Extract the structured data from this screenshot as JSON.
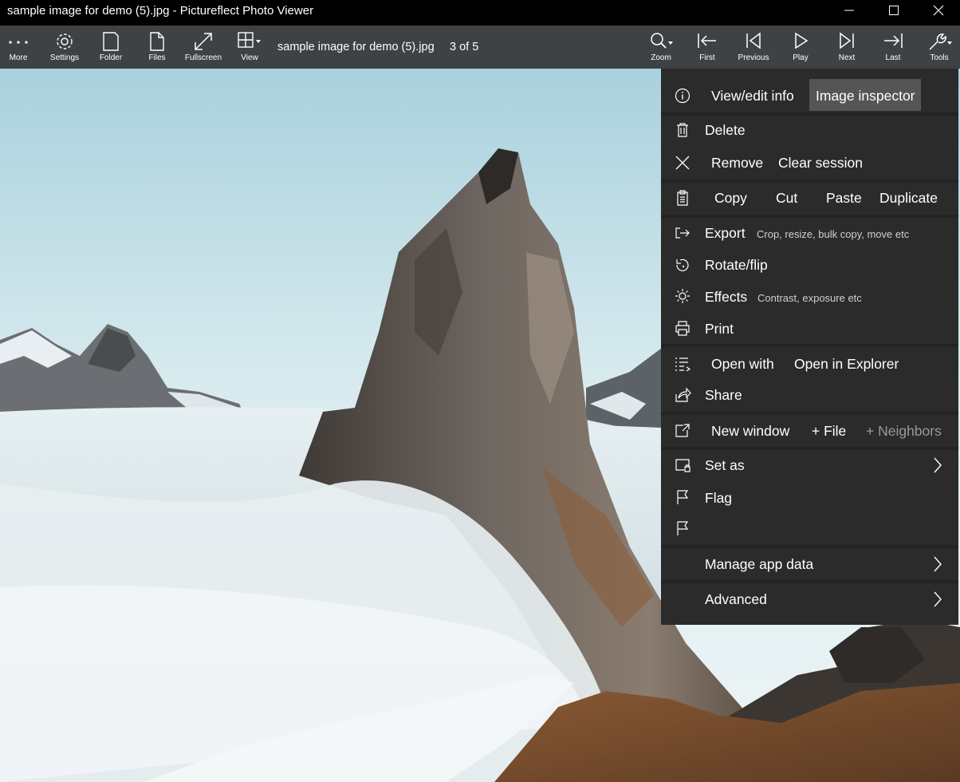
{
  "window": {
    "title": "sample image for demo (5).jpg - Pictureflect Photo Viewer",
    "minimize_icon": "minimize-icon",
    "maximize_icon": "maximize-icon",
    "close_icon": "close-icon"
  },
  "toolbar": {
    "left_buttons": [
      {
        "label": "More",
        "icon": "more-dots-icon"
      },
      {
        "label": "Settings",
        "icon": "gear-icon"
      },
      {
        "label": "Folder",
        "icon": "folder-icon"
      },
      {
        "label": "Files",
        "icon": "files-icon"
      },
      {
        "label": "Fullscreen",
        "icon": "fullscreen-icon"
      },
      {
        "label": "View",
        "icon": "grid-view-icon"
      }
    ],
    "file_name": "sample image for demo (5).jpg",
    "position": "3 of 5",
    "right_buttons": [
      {
        "label": "Zoom",
        "icon": "zoom-icon"
      },
      {
        "label": "First",
        "icon": "first-icon"
      },
      {
        "label": "Previous",
        "icon": "previous-icon"
      },
      {
        "label": "Play",
        "icon": "play-icon"
      },
      {
        "label": "Next",
        "icon": "next-icon"
      },
      {
        "label": "Last",
        "icon": "last-icon"
      },
      {
        "label": "Tools",
        "icon": "tools-icon"
      }
    ]
  },
  "menu": {
    "view_edit_info": "View/edit info",
    "image_inspector": "Image inspector",
    "delete": "Delete",
    "remove": "Remove",
    "clear_session": "Clear session",
    "copy": "Copy",
    "cut": "Cut",
    "paste": "Paste",
    "duplicate": "Duplicate",
    "export": "Export",
    "export_sub": "Crop, resize, bulk copy, move etc",
    "rotate_flip": "Rotate/flip",
    "effects": "Effects",
    "effects_sub": "Contrast, exposure etc",
    "print": "Print",
    "open_with": "Open with",
    "open_in_explorer": "Open in Explorer",
    "share": "Share",
    "new_window": "New window",
    "plus_file": "+ File",
    "plus_neighbors": "+ Neighbors",
    "set_as": "Set as",
    "flag": "Flag",
    "manage_app_data": "Manage app data",
    "advanced": "Advanced",
    "highlight_color": "#555555",
    "background_color": "#2b2b2b"
  }
}
